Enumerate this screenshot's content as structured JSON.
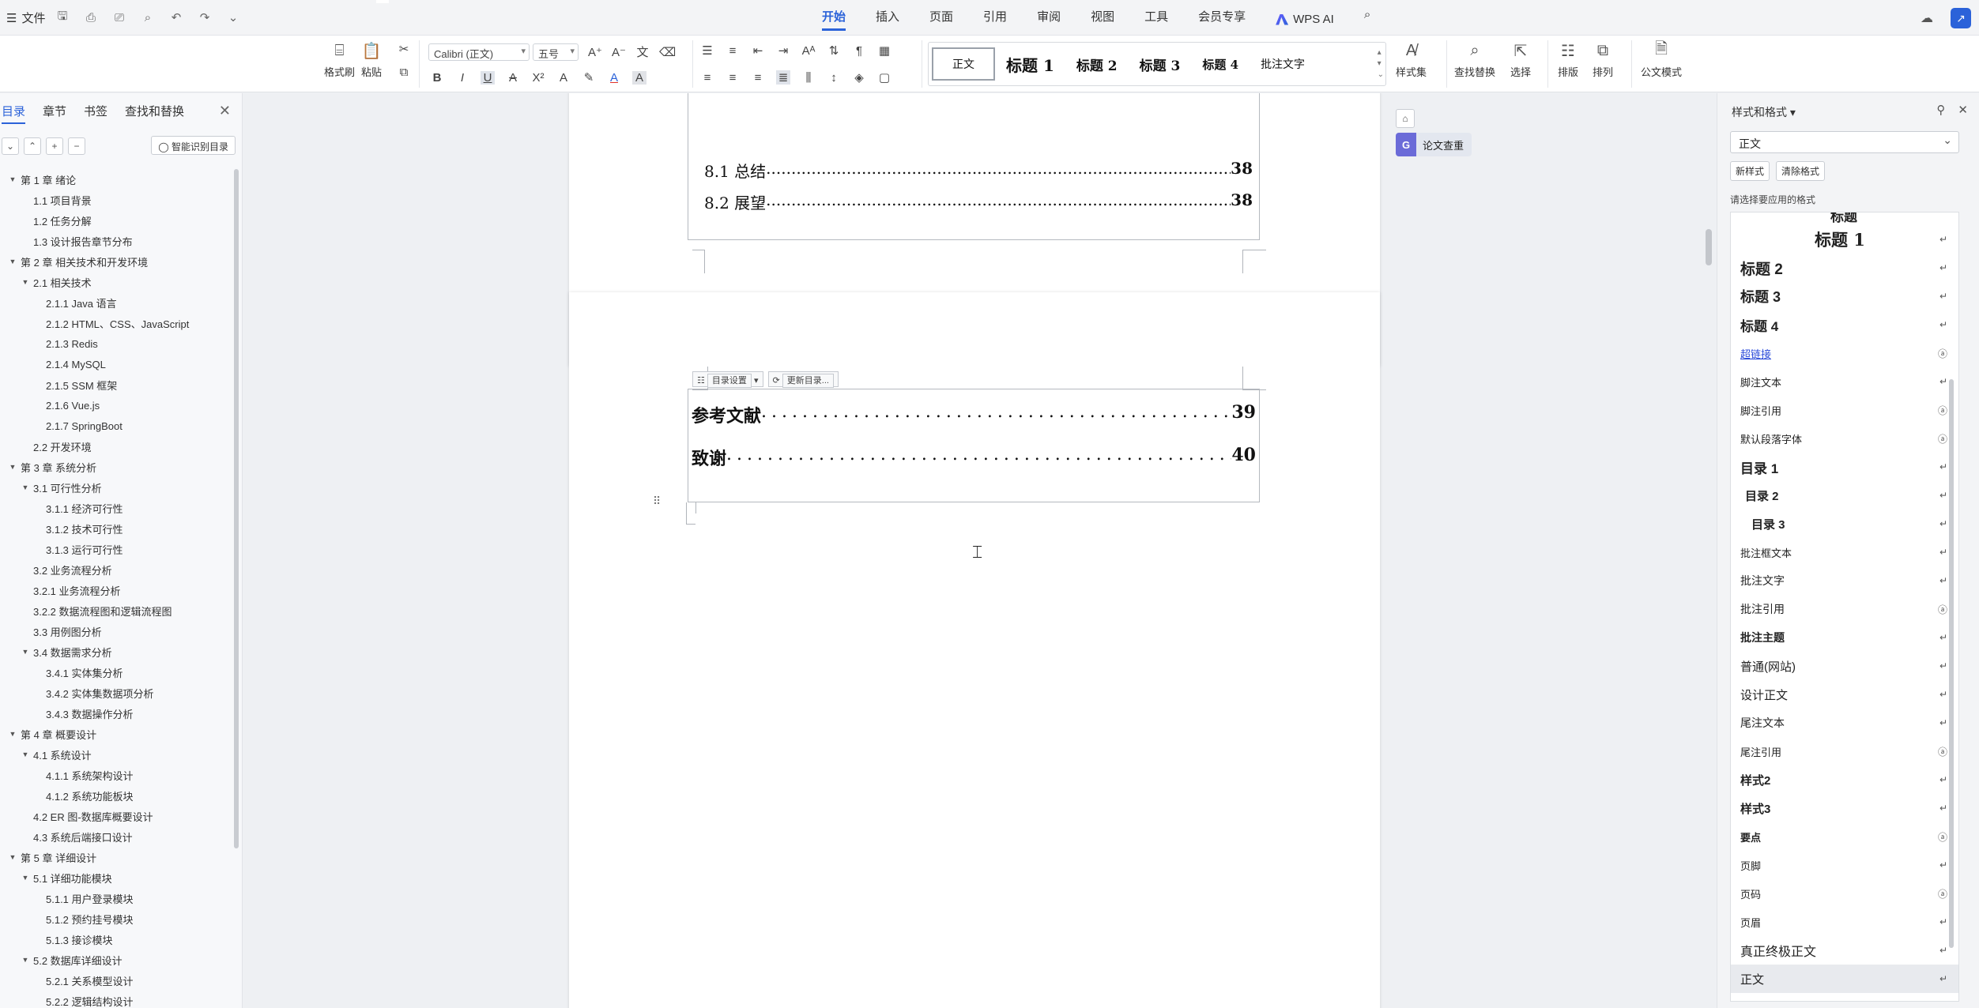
{
  "title_bar": {
    "file_label": "文件",
    "tabs": [
      {
        "label": "开始",
        "active": true
      },
      {
        "label": "插入"
      },
      {
        "label": "页面"
      },
      {
        "label": "引用"
      },
      {
        "label": "审阅"
      },
      {
        "label": "视图"
      },
      {
        "label": "工具"
      },
      {
        "label": "会员专享"
      }
    ],
    "wps_ai_label": "WPS AI"
  },
  "ribbon": {
    "format_painter": "格式刷",
    "paste": "粘贴",
    "font_name": "Calibri (正文)",
    "font_size": "五号",
    "style_gallery": [
      "正文",
      "标题 1",
      "标题 2",
      "标题 3",
      "标题 4",
      "批注文字"
    ],
    "style_set": "样式集",
    "find_replace": "查找替换",
    "select": "选择",
    "layout": "排版",
    "arrange": "排列",
    "official_mode": "公文模式"
  },
  "nav_panel": {
    "tabs": [
      "目录",
      "章节",
      "书签",
      "查找和替换"
    ],
    "smart_toc": "智能识别目录",
    "items": [
      {
        "text": "第 1 章 绪论",
        "level": 0,
        "tri": "▼"
      },
      {
        "text": "1.1 项目背景",
        "level": 1
      },
      {
        "text": "1.2 任务分解",
        "level": 1
      },
      {
        "text": "1.3 设计报告章节分布",
        "level": 1
      },
      {
        "text": "第 2 章 相关技术和开发环境",
        "level": 0,
        "tri": "▼"
      },
      {
        "text": "2.1 相关技术",
        "level": 1,
        "tri": "▼"
      },
      {
        "text": "2.1.1 Java 语言",
        "level": 2
      },
      {
        "text": "2.1.2 HTML、CSS、JavaScript",
        "level": 2
      },
      {
        "text": "2.1.3 Redis",
        "level": 2
      },
      {
        "text": "2.1.4 MySQL",
        "level": 2
      },
      {
        "text": "2.1.5 SSM 框架",
        "level": 2
      },
      {
        "text": "2.1.6 Vue.js",
        "level": 2
      },
      {
        "text": "2.1.7 SpringBoot",
        "level": 2
      },
      {
        "text": "2.2 开发环境",
        "level": 1
      },
      {
        "text": "第 3 章 系统分析",
        "level": 0,
        "tri": "▼"
      },
      {
        "text": "3.1 可行性分析",
        "level": 1,
        "tri": "▼"
      },
      {
        "text": "3.1.1 经济可行性",
        "level": 2
      },
      {
        "text": "3.1.2 技术可行性",
        "level": 2
      },
      {
        "text": "3.1.3 运行可行性",
        "level": 2
      },
      {
        "text": "3.2 业务流程分析",
        "level": 1
      },
      {
        "text": "3.2.1 业务流程分析",
        "level": 1
      },
      {
        "text": "3.2.2 数据流程图和逻辑流程图",
        "level": 1
      },
      {
        "text": "3.3 用例图分析",
        "level": 1
      },
      {
        "text": "3.4 数据需求分析",
        "level": 1,
        "tri": "▼"
      },
      {
        "text": "3.4.1 实体集分析",
        "level": 2
      },
      {
        "text": "3.4.2 实体集数据项分析",
        "level": 2
      },
      {
        "text": "3.4.3 数据操作分析",
        "level": 2
      },
      {
        "text": "第 4 章 概要设计",
        "level": 0,
        "tri": "▼"
      },
      {
        "text": "4.1 系统设计",
        "level": 1,
        "tri": "▼"
      },
      {
        "text": "4.1.1 系统架构设计",
        "level": 2
      },
      {
        "text": "4.1.2 系统功能板块",
        "level": 2
      },
      {
        "text": "4.2 ER 图-数据库概要设计",
        "level": 1
      },
      {
        "text": "4.3 系统后端接口设计",
        "level": 1
      },
      {
        "text": "第 5 章 详细设计",
        "level": 0,
        "tri": "▼"
      },
      {
        "text": "5.1 详细功能模块",
        "level": 1,
        "tri": "▼"
      },
      {
        "text": "5.1.1 用户登录模块",
        "level": 2
      },
      {
        "text": "5.1.2 预约挂号模块",
        "level": 2
      },
      {
        "text": "5.1.3 接诊模块",
        "level": 2
      },
      {
        "text": "5.2 数据库详细设计",
        "level": 1,
        "tri": "▼"
      },
      {
        "text": "5.2.1 关系模型设计",
        "level": 2
      },
      {
        "text": "5.2.2 逻辑结构设计",
        "level": 2
      }
    ]
  },
  "document": {
    "page1_entries": [
      {
        "label": "8.1 总结",
        "page": "38"
      },
      {
        "label": "8.2 展望",
        "page": "38"
      }
    ],
    "toc_toolbar": [
      "目录设置",
      "更新目录..."
    ],
    "page2_entries": [
      {
        "label": "参考文献",
        "page": "39"
      },
      {
        "label": "致谢",
        "page": "40"
      }
    ],
    "plagiarism_check": "论文查重"
  },
  "styles_panel": {
    "title": "样式和格式",
    "current_style": "正文",
    "new_style": "新样式",
    "clear_format": "清除格式",
    "hint": "请选择要应用的格式",
    "items": [
      {
        "text": "标题",
        "size": 17,
        "bold": true,
        "center": true,
        "mark": ""
      },
      {
        "text": "标题 1",
        "size": 21,
        "bold": true,
        "center": true,
        "mark": "↵"
      },
      {
        "text": "标题 2",
        "size": 19,
        "bold": true,
        "mark": "↵"
      },
      {
        "text": "标题 3",
        "size": 18,
        "bold": true,
        "mark": "↵"
      },
      {
        "text": "标题 4",
        "size": 17,
        "bold": true,
        "mark": "↵"
      },
      {
        "text": "超链接",
        "size": 13,
        "link": true,
        "mark": "a"
      },
      {
        "text": "脚注文本",
        "size": 13,
        "mark": "↵"
      },
      {
        "text": "脚注引用",
        "size": 13,
        "mark": "a"
      },
      {
        "text": "默认段落字体",
        "size": 13,
        "mark": "a"
      },
      {
        "text": "目录 1",
        "size": 17,
        "bold": true,
        "mark": "↵"
      },
      {
        "text": "目录 2",
        "size": 15,
        "bold": true,
        "indent": 6,
        "mark": "↵"
      },
      {
        "text": "目录 3",
        "size": 15,
        "bold": true,
        "indent": 14,
        "mark": "↵"
      },
      {
        "text": "批注框文本",
        "size": 13,
        "mark": "↵"
      },
      {
        "text": "批注文字",
        "size": 14,
        "mark": "↵"
      },
      {
        "text": "批注引用",
        "size": 14,
        "mark": "a"
      },
      {
        "text": "批注主题",
        "size": 14,
        "bold": true,
        "mark": "↵"
      },
      {
        "text": "普通(网站)",
        "size": 15,
        "mark": "↵"
      },
      {
        "text": "设计正文",
        "size": 15,
        "mark": "↵"
      },
      {
        "text": "尾注文本",
        "size": 14,
        "mark": "↵"
      },
      {
        "text": "尾注引用",
        "size": 13,
        "mark": "a"
      },
      {
        "text": "样式2",
        "size": 15,
        "bold": true,
        "mark": "↵"
      },
      {
        "text": "样式3",
        "size": 15,
        "bold": true,
        "mark": "↵"
      },
      {
        "text": "要点",
        "size": 13,
        "bold": true,
        "mark": "a"
      },
      {
        "text": "页脚",
        "size": 13,
        "mark": "↵"
      },
      {
        "text": "页码",
        "size": 13,
        "mark": "a"
      },
      {
        "text": "页眉",
        "size": 13,
        "mark": "↵"
      },
      {
        "text": "真正终极正文",
        "size": 16,
        "mark": "↵"
      },
      {
        "text": "正文",
        "size": 15,
        "mark": "↵",
        "selected": true
      }
    ]
  },
  "colors": {
    "accent": "#2b62d9",
    "link": "#2b4bd9"
  }
}
